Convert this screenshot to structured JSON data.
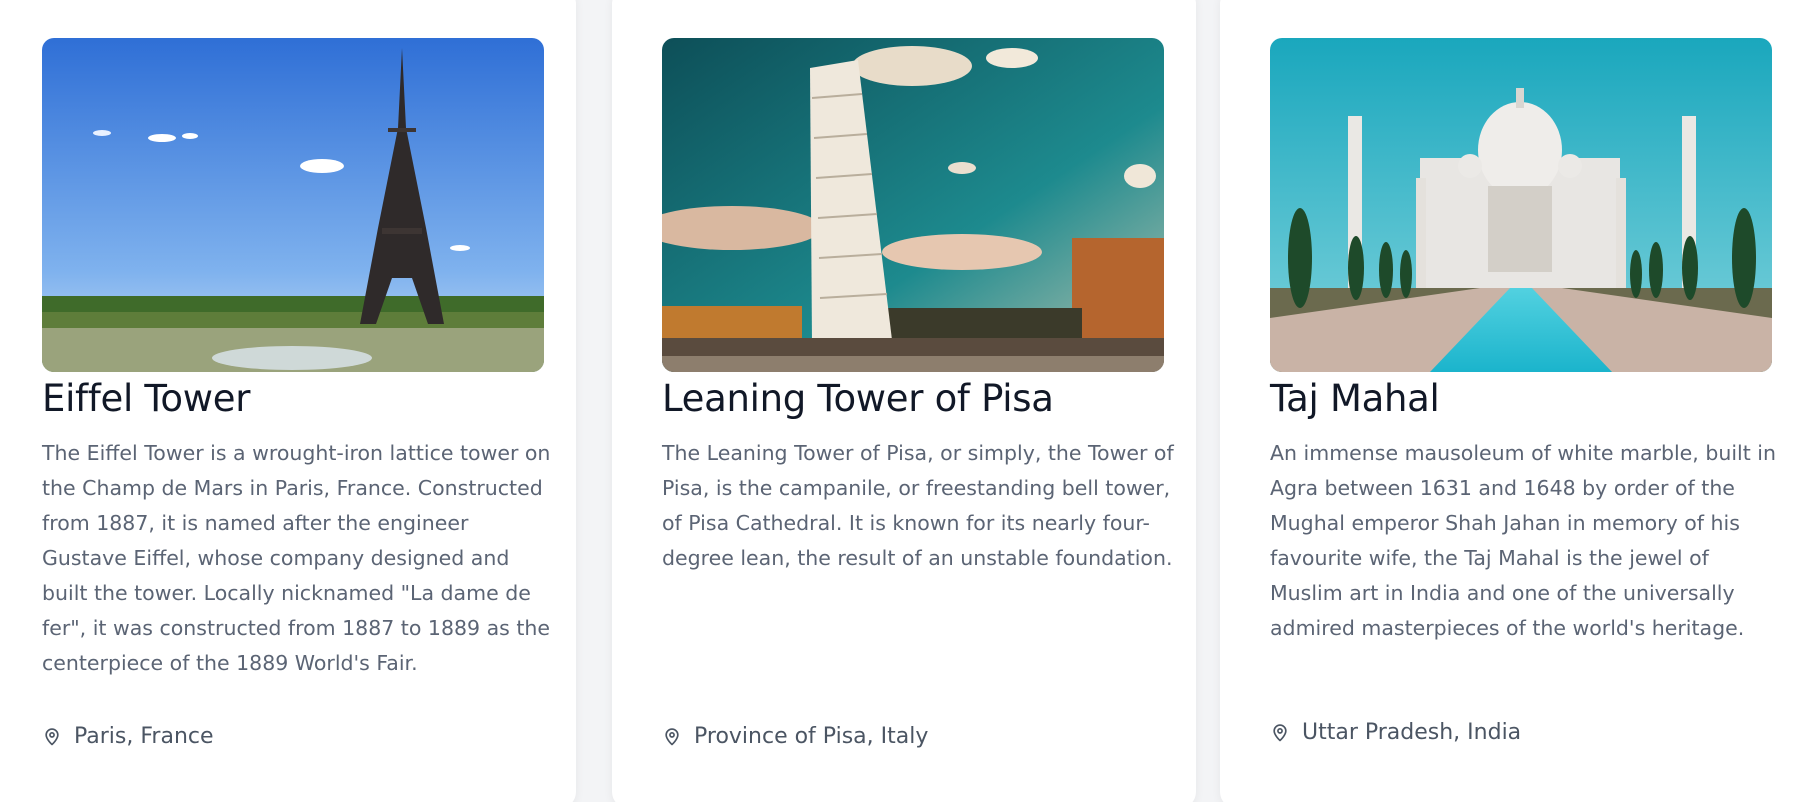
{
  "cards": [
    {
      "title": "Eiffel Tower",
      "description": "The Eiffel Tower is a wrought-iron lattice tower on the Champ de Mars in Paris, France. Constructed from 1887, it is named after the engineer Gustave Eiffel, whose company designed and built the tower. Locally nicknamed \"La dame de fer\", it was constructed from 1887 to 1889 as the centerpiece of the 1889 World's Fair.",
      "location": "Paris, France",
      "location_icon": "map-pin-icon",
      "image": "eiffel-tower-photo"
    },
    {
      "title": "Leaning Tower of Pisa",
      "description": "The Leaning Tower of Pisa, or simply, the Tower of Pisa, is the campanile, or freestanding bell tower, of Pisa Cathedral. It is known for its nearly four-degree lean, the result of an unstable foundation.",
      "location": "Province of Pisa, Italy",
      "location_icon": "map-pin-icon",
      "image": "pisa-tower-photo"
    },
    {
      "title": "Taj Mahal",
      "description": "An immense mausoleum of white marble, built in Agra between 1631 and 1648 by order of the Mughal emperor Shah Jahan in memory of his favourite wife, the Taj Mahal is the jewel of Muslim art in India and one of the universally admired masterpieces of the world's heritage.",
      "location": "Uttar Pradesh, India",
      "location_icon": "map-pin-icon",
      "image": "taj-mahal-photo"
    }
  ],
  "colors": {
    "title": "#111827",
    "description": "#5b6474",
    "location": "#4b5563",
    "card_background": "#ffffff",
    "page_background": "#f3f4f6"
  }
}
